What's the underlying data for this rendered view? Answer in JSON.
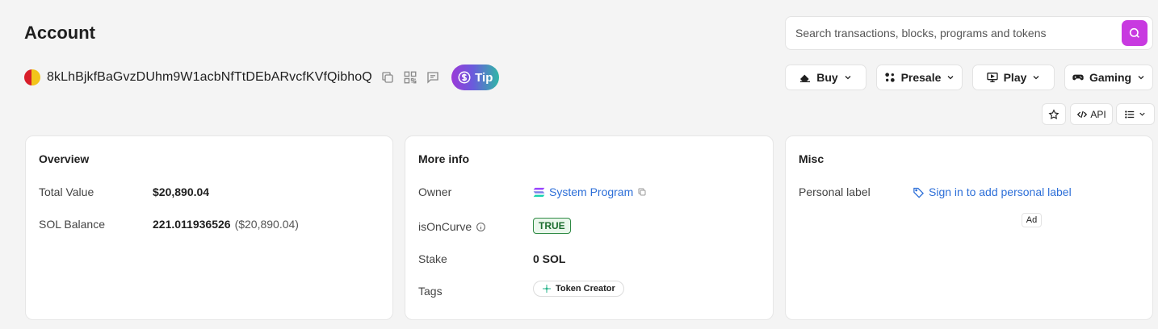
{
  "header": {
    "title": "Account",
    "address": "8kLhBjkfBaGvzDUhm9W1acbNfTtDEbARvcfKVfQibhoQ",
    "tip_label": "Tip"
  },
  "search": {
    "placeholder": "Search transactions, blocks, programs and tokens",
    "value": ""
  },
  "nav": {
    "buy": "Buy",
    "presale": "Presale",
    "play": "Play",
    "gaming": "Gaming"
  },
  "toolbar": {
    "api_label": "API"
  },
  "overview": {
    "title": "Overview",
    "total_value_label": "Total Value",
    "total_value": "$20,890.04",
    "sol_balance_label": "SOL Balance",
    "sol_balance": "221.011936526",
    "sol_balance_usd": "($20,890.04)"
  },
  "more_info": {
    "title": "More info",
    "owner_label": "Owner",
    "owner_value": "System Program",
    "is_on_curve_label": "isOnCurve",
    "is_on_curve_value": "TRUE",
    "stake_label": "Stake",
    "stake_value": "0 SOL",
    "tags_label": "Tags",
    "tag": "Token Creator"
  },
  "misc": {
    "title": "Misc",
    "personal_label_label": "Personal label",
    "personal_label_link": "Sign in to add personal label",
    "ad_label": "Ad"
  },
  "colors": {
    "accent": "#c83ae0",
    "link": "#2d6fd8",
    "true_badge": "#2f8a44"
  }
}
